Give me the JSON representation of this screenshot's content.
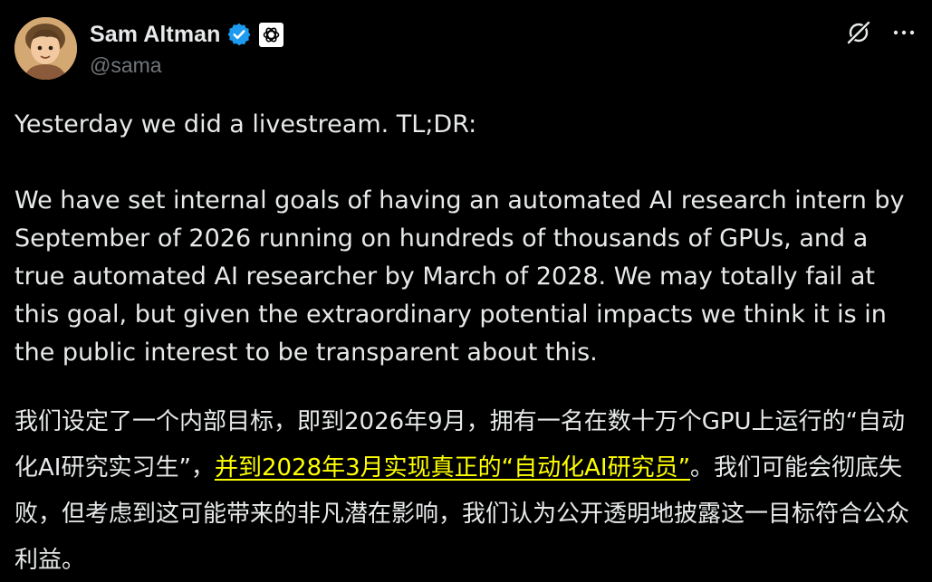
{
  "author": {
    "display_name": "Sam Altman",
    "handle": "@sama",
    "avatar_icon": "cartoon-avatar",
    "verified_icon": "verified-badge-icon",
    "affiliation_icon": "openai-logo-icon"
  },
  "actions": {
    "grok_icon": "grok-icon",
    "more_icon": "more-icon"
  },
  "tweet": {
    "para1": "Yesterday we did a livestream. TL;DR:",
    "para2": "We have set internal goals of having an automated AI research intern by September of 2026 running on hundreds of thousands of GPUs, and a true automated AI researcher by March of 2028. We may totally fail at this goal, but given the extraordinary potential impacts we think it is in the public interest to be transparent about this.",
    "zh_part1": "我们设定了一个内部目标，即到2026年9月，拥有一名在数十万个GPU上运行的“自动化AI研究实习生”，",
    "zh_highlight": "并到2028年3月实现真正的“自动化AI研究员”",
    "zh_part2": "。我们可能会彻底失败，但考虑到这可能带来的非凡潜在影响，我们认为公开透明地披露这一目标符合公众利益。"
  },
  "colors": {
    "background": "#000000",
    "text": "#e7e9ea",
    "handle": "#71767b",
    "verified": "#1d9bf0",
    "highlight": "#ffff00"
  }
}
